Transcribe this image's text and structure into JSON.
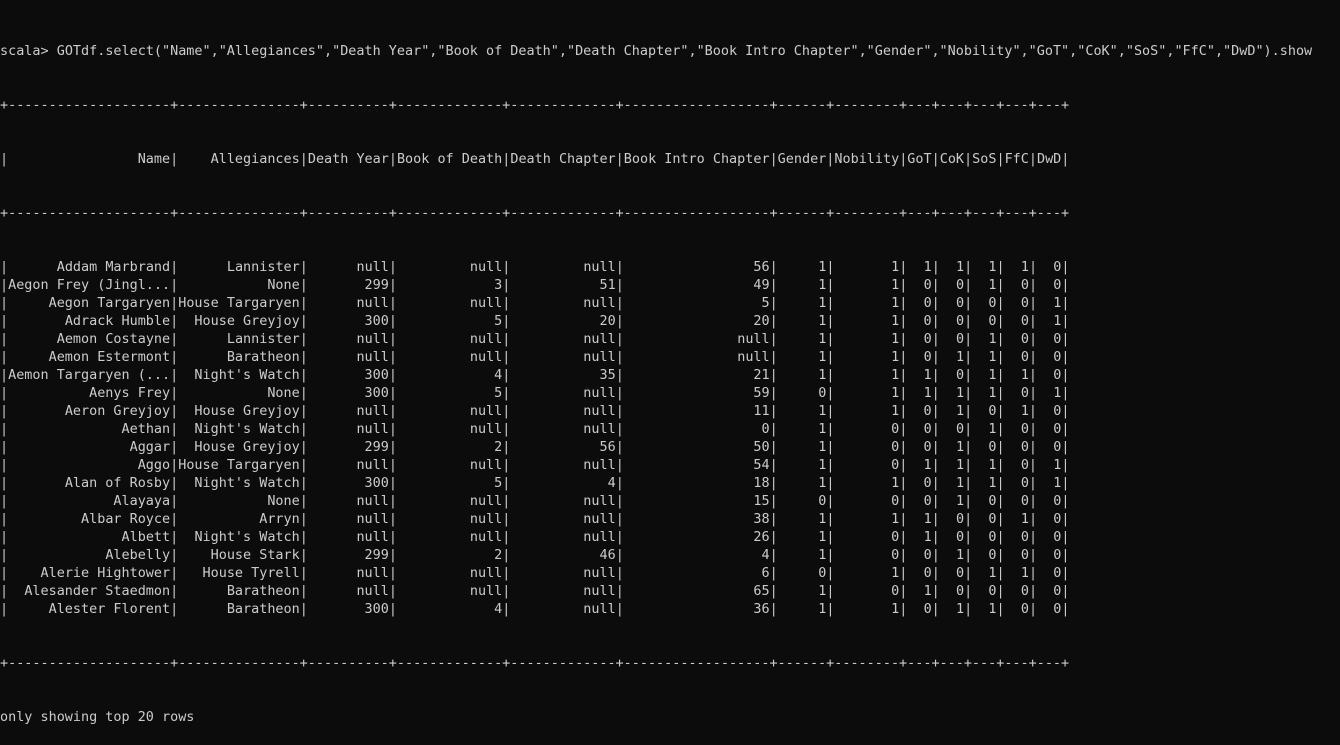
{
  "terminal": {
    "prompt": "scala>",
    "command": "GOTdf.select(\"Name\",\"Allegiances\",\"Death Year\",\"Book of Death\",\"Death Chapter\",\"Book Intro Chapter\",\"Gender\",\"Nobility\",\"GoT\",\"CoK\",\"SoS\",\"FfC\",\"DwD\").show",
    "footer": "only showing top 20 rows",
    "colors": {
      "background": "#0c0c0c",
      "text": "#cccccc"
    }
  },
  "table": {
    "columns": [
      "Name",
      "Allegiances",
      "Death Year",
      "Book of Death",
      "Death Chapter",
      "Book Intro Chapter",
      "Gender",
      "Nobility",
      "GoT",
      "CoK",
      "SoS",
      "FfC",
      "DwD"
    ],
    "rows": [
      [
        "Addam Marbrand",
        "Lannister",
        "null",
        "null",
        "null",
        "56",
        "1",
        "1",
        "1",
        "1",
        "1",
        "1",
        "0"
      ],
      [
        "Aegon Frey (Jingl...",
        "None",
        "299",
        "3",
        "51",
        "49",
        "1",
        "1",
        "0",
        "0",
        "1",
        "0",
        "0"
      ],
      [
        "Aegon Targaryen",
        "House Targaryen",
        "null",
        "null",
        "null",
        "5",
        "1",
        "1",
        "0",
        "0",
        "0",
        "0",
        "1"
      ],
      [
        "Adrack Humble",
        "House Greyjoy",
        "300",
        "5",
        "20",
        "20",
        "1",
        "1",
        "0",
        "0",
        "0",
        "0",
        "1"
      ],
      [
        "Aemon Costayne",
        "Lannister",
        "null",
        "null",
        "null",
        "null",
        "1",
        "1",
        "0",
        "0",
        "1",
        "0",
        "0"
      ],
      [
        "Aemon Estermont",
        "Baratheon",
        "null",
        "null",
        "null",
        "null",
        "1",
        "1",
        "0",
        "1",
        "1",
        "0",
        "0"
      ],
      [
        "Aemon Targaryen (...",
        "Night's Watch",
        "300",
        "4",
        "35",
        "21",
        "1",
        "1",
        "1",
        "0",
        "1",
        "1",
        "0"
      ],
      [
        "Aenys Frey",
        "None",
        "300",
        "5",
        "null",
        "59",
        "0",
        "1",
        "1",
        "1",
        "1",
        "0",
        "1"
      ],
      [
        "Aeron Greyjoy",
        "House Greyjoy",
        "null",
        "null",
        "null",
        "11",
        "1",
        "1",
        "0",
        "1",
        "0",
        "1",
        "0"
      ],
      [
        "Aethan",
        "Night's Watch",
        "null",
        "null",
        "null",
        "0",
        "1",
        "0",
        "0",
        "0",
        "1",
        "0",
        "0"
      ],
      [
        "Aggar",
        "House Greyjoy",
        "299",
        "2",
        "56",
        "50",
        "1",
        "0",
        "0",
        "1",
        "0",
        "0",
        "0"
      ],
      [
        "Aggo",
        "House Targaryen",
        "null",
        "null",
        "null",
        "54",
        "1",
        "0",
        "1",
        "1",
        "1",
        "0",
        "1"
      ],
      [
        "Alan of Rosby",
        "Night's Watch",
        "300",
        "5",
        "4",
        "18",
        "1",
        "1",
        "0",
        "1",
        "1",
        "0",
        "1"
      ],
      [
        "Alayaya",
        "None",
        "null",
        "null",
        "null",
        "15",
        "0",
        "0",
        "0",
        "1",
        "0",
        "0",
        "0"
      ],
      [
        "Albar Royce",
        "Arryn",
        "null",
        "null",
        "null",
        "38",
        "1",
        "1",
        "1",
        "0",
        "0",
        "1",
        "0"
      ],
      [
        "Albett",
        "Night's Watch",
        "null",
        "null",
        "null",
        "26",
        "1",
        "0",
        "1",
        "0",
        "0",
        "0",
        "0"
      ],
      [
        "Alebelly",
        "House Stark",
        "299",
        "2",
        "46",
        "4",
        "1",
        "0",
        "0",
        "1",
        "0",
        "0",
        "0"
      ],
      [
        "Alerie Hightower",
        "House Tyrell",
        "null",
        "null",
        "null",
        "6",
        "0",
        "1",
        "0",
        "0",
        "1",
        "1",
        "0"
      ],
      [
        "Alesander Staedmon",
        "Baratheon",
        "null",
        "null",
        "null",
        "65",
        "1",
        "0",
        "1",
        "0",
        "0",
        "0",
        "0"
      ],
      [
        "Alester Florent",
        "Baratheon",
        "300",
        "4",
        "null",
        "36",
        "1",
        "1",
        "0",
        "1",
        "1",
        "0",
        "0"
      ]
    ]
  }
}
